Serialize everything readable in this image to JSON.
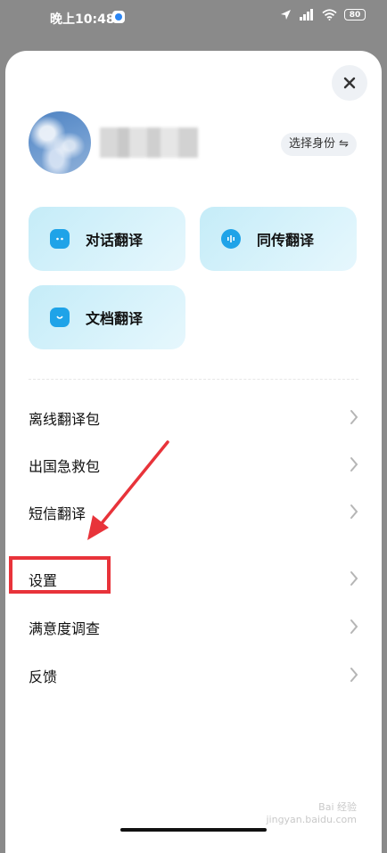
{
  "status_bar": {
    "time": "晚上10:48",
    "battery": "80",
    "icons": [
      "location-icon",
      "signal-icon",
      "wifi-icon",
      "battery-icon"
    ]
  },
  "profile": {
    "identity_button": "选择身份 ⇋"
  },
  "features": [
    {
      "label": "对话翻译",
      "icon": "chat-icon"
    },
    {
      "label": "同传翻译",
      "icon": "voice-icon"
    },
    {
      "label": "文档翻译",
      "icon": "document-icon"
    }
  ],
  "menu": [
    {
      "label": "离线翻译包"
    },
    {
      "label": "出国急救包"
    },
    {
      "label": "短信翻译"
    },
    {
      "label": "设置"
    },
    {
      "label": "满意度调查"
    },
    {
      "label": "反馈"
    }
  ],
  "watermark": {
    "line1": "Bai 经验",
    "line2": "jingyan.baidu.com"
  },
  "colors": {
    "accent": "#1fa3e8",
    "tile_bg": "#d6f1fa",
    "highlight": "#e8333a"
  }
}
